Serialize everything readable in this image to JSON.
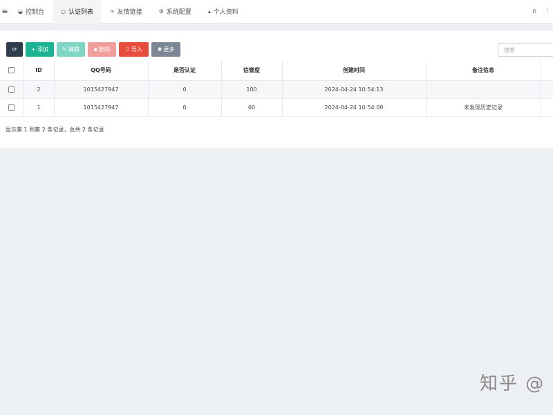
{
  "nav": {
    "tabs": [
      {
        "icon": "dashboard-icon",
        "glyph": "◒",
        "label": "控制台"
      },
      {
        "icon": "circle-icon",
        "glyph": "○",
        "label": "认证列表"
      },
      {
        "icon": "link-icon",
        "glyph": "∞",
        "label": "友情链接"
      },
      {
        "icon": "gear-icon",
        "glyph": "⚙",
        "label": "系统配置"
      },
      {
        "icon": "user-icon",
        "glyph": "▴",
        "label": "个人资料"
      }
    ],
    "active_tab": "认证列表"
  },
  "toolbar": {
    "add_label": "添加",
    "edit_label": "编辑",
    "delete_label": "删除",
    "import_label": "导入",
    "more_label": "更多"
  },
  "search": {
    "placeholder": "搜索"
  },
  "table": {
    "columns": [
      "ID",
      "QQ号码",
      "是否认证",
      "信誉度",
      "创建时间",
      "备注信息"
    ],
    "rows": [
      {
        "id": "2",
        "qq": "1015427947",
        "verified": "0",
        "credit": "100",
        "created": "2024-04-24 10:54:13",
        "remark": ""
      },
      {
        "id": "1",
        "qq": "1015427947",
        "verified": "0",
        "credit": "60",
        "created": "2024-04-24 10:54:00",
        "remark": "未发现历史记录"
      }
    ]
  },
  "pagination": {
    "info": "显示第 1 到第 2 条记录，总共 2 条记录"
  },
  "watermark": {
    "text": "知乎 @"
  },
  "colors": {
    "refresh": "#2f3e4d",
    "add": "#1ab394",
    "edit": "#7fd6c4",
    "delete": "#f29e9c",
    "import": "#e74c3c",
    "more": "#7b8794"
  }
}
